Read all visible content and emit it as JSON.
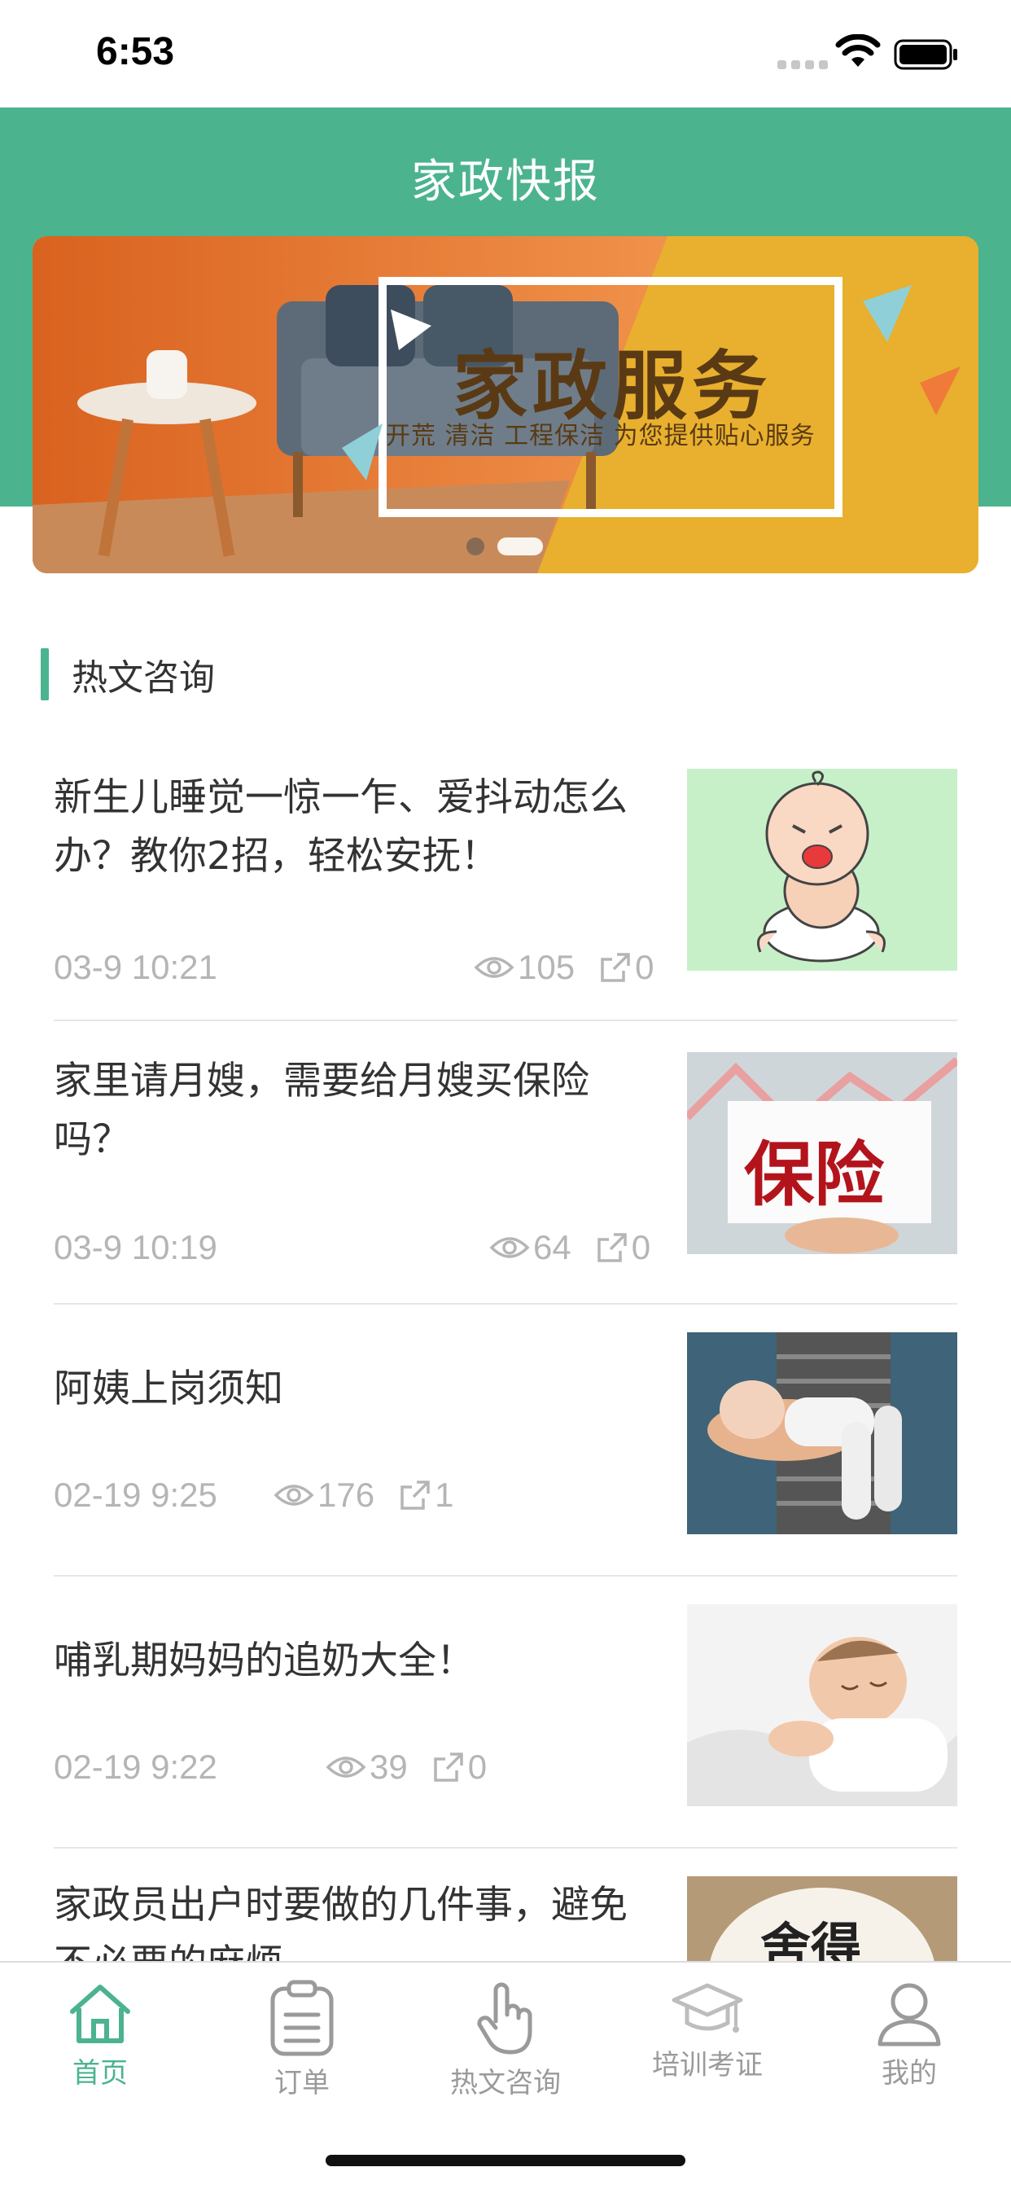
{
  "status_bar": {
    "time": "6:53"
  },
  "header": {
    "title": "家政快报"
  },
  "banner": {
    "main_text": "家政服务",
    "sub_text": "开荒 清洁 工程保洁   为您提供贴心服务",
    "slide_count": 2,
    "active_slide": 2
  },
  "section": {
    "title": "热文咨询"
  },
  "articles": [
    {
      "title": "新生儿睡觉一惊一乍、爱抖动怎么办？教你2招，轻松安抚！",
      "date": "03-9 10:21",
      "views": "105",
      "shares": "0",
      "thumb_icon": "crying-baby-illustration"
    },
    {
      "title": "家里请月嫂，需要给月嫂买保险吗？",
      "date": "03-9 10:19",
      "views": "64",
      "shares": "0",
      "thumb_icon": "insurance-card-photo",
      "thumb_text": "保险"
    },
    {
      "title": "阿姨上岗须知",
      "date": "02-19 9:25",
      "views": "176",
      "shares": "1",
      "thumb_icon": "holding-baby-photo"
    },
    {
      "title": "哺乳期妈妈的追奶大全！",
      "date": "02-19 9:22",
      "views": "39",
      "shares": "0",
      "thumb_icon": "sleeping-baby-photo"
    },
    {
      "title": "家政员出户时要做的几件事，避免不必要的麻烦",
      "thumb_icon": "calligraphy-plate-photo",
      "thumb_text": "舍得"
    }
  ],
  "tab_bar": {
    "items": [
      {
        "label": "首页",
        "icon": "home-icon",
        "active": true
      },
      {
        "label": "订单",
        "icon": "clipboard-icon",
        "active": false
      },
      {
        "label": "热文咨询",
        "icon": "hand-pointer-icon",
        "active": false
      },
      {
        "label": "培训考证",
        "icon": "graduation-cap-icon",
        "active": false
      },
      {
        "label": "我的",
        "icon": "user-icon",
        "active": false
      }
    ]
  },
  "colors": {
    "accent": "#4cb38f",
    "meta_text": "#b5b5b5",
    "title_text": "#333333"
  }
}
